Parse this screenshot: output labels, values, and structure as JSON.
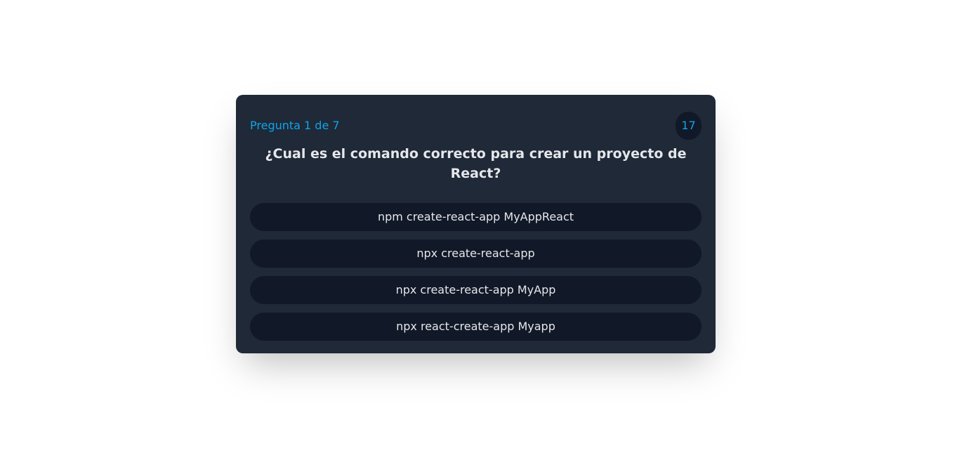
{
  "quiz": {
    "counter": "Pregunta 1 de 7",
    "timer": "17",
    "question": "¿Cual es el comando correcto para crear un proyecto de React?",
    "answers": [
      "npm create-react-app MyAppReact",
      "npx create-react-app",
      "npx create-react-app MyApp",
      "npx react-create-app Myapp"
    ]
  },
  "colors": {
    "card_bg": "#1f2937",
    "button_bg": "#111827",
    "accent": "#0ea5e9",
    "text": "#e5e7eb"
  }
}
